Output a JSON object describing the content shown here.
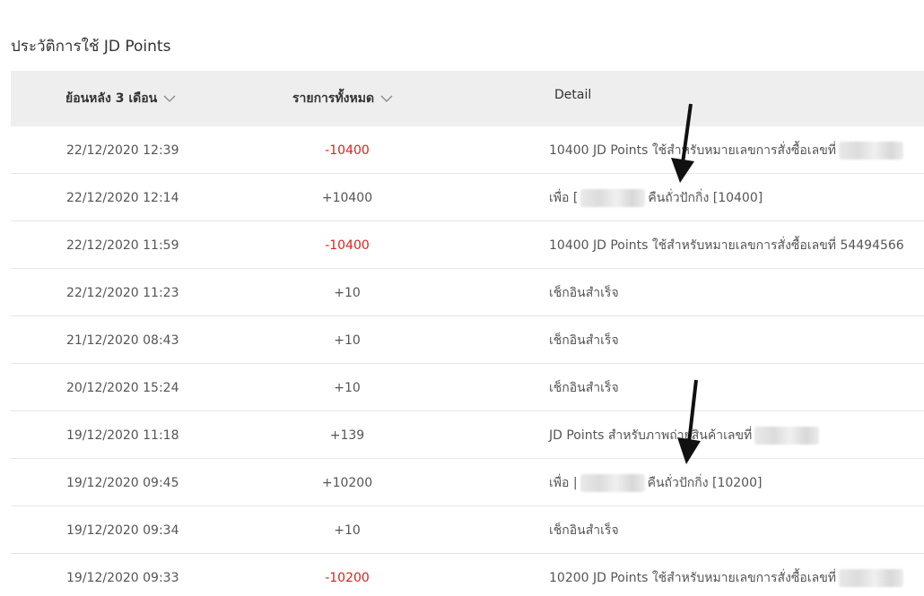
{
  "page": {
    "title": "ประวัติการใช้ JD Points"
  },
  "header": {
    "date_filter_label": "ย้อนหลัง 3 เดือน",
    "type_filter_label": "รายการทั้งหมด",
    "detail_label": "Detail"
  },
  "colors": {
    "negative": "#e02020",
    "header_bg": "#eeeeee"
  },
  "rows": [
    {
      "date": "22/12/2020 12:39",
      "points": "-10400",
      "negative": true,
      "detail_pre": "10400 JD Points ใช้สำหรับหมายเลขการสั่งซื้อเลขที่",
      "redacted": true,
      "detail_post": ""
    },
    {
      "date": "22/12/2020 12:14",
      "points": "+10400",
      "negative": false,
      "detail_pre": "เพื่อ [",
      "redacted": true,
      "detail_post": "คืนถั่วปักกิ่ง [10400]"
    },
    {
      "date": "22/12/2020 11:59",
      "points": "-10400",
      "negative": true,
      "detail_pre": "10400 JD Points ใช้สำหรับหมายเลขการสั่งซื้อเลขที่ 54494566",
      "redacted": false,
      "detail_post": ""
    },
    {
      "date": "22/12/2020 11:23",
      "points": "+10",
      "negative": false,
      "detail_pre": "เช็กอินสำเร็จ",
      "redacted": false,
      "detail_post": ""
    },
    {
      "date": "21/12/2020 08:43",
      "points": "+10",
      "negative": false,
      "detail_pre": "เช็กอินสำเร็จ",
      "redacted": false,
      "detail_post": ""
    },
    {
      "date": "20/12/2020 15:24",
      "points": "+10",
      "negative": false,
      "detail_pre": "เช็กอินสำเร็จ",
      "redacted": false,
      "detail_post": ""
    },
    {
      "date": "19/12/2020 11:18",
      "points": "+139",
      "negative": false,
      "detail_pre": "JD Points สำหรับภาพถ่ายสินค้าเลขที่",
      "redacted": true,
      "detail_post": ""
    },
    {
      "date": "19/12/2020 09:45",
      "points": "+10200",
      "negative": false,
      "detail_pre": "เพื่อ |",
      "redacted": true,
      "detail_post": "คืนถั่วปักกิ่ง [10200]"
    },
    {
      "date": "19/12/2020 09:34",
      "points": "+10",
      "negative": false,
      "detail_pre": "เช็กอินสำเร็จ",
      "redacted": false,
      "detail_post": ""
    },
    {
      "date": "19/12/2020 09:33",
      "points": "-10200",
      "negative": true,
      "detail_pre": "10200 JD Points ใช้สำหรับหมายเลขการสั่งซื้อเลขที่",
      "redacted": true,
      "detail_post": ""
    }
  ]
}
